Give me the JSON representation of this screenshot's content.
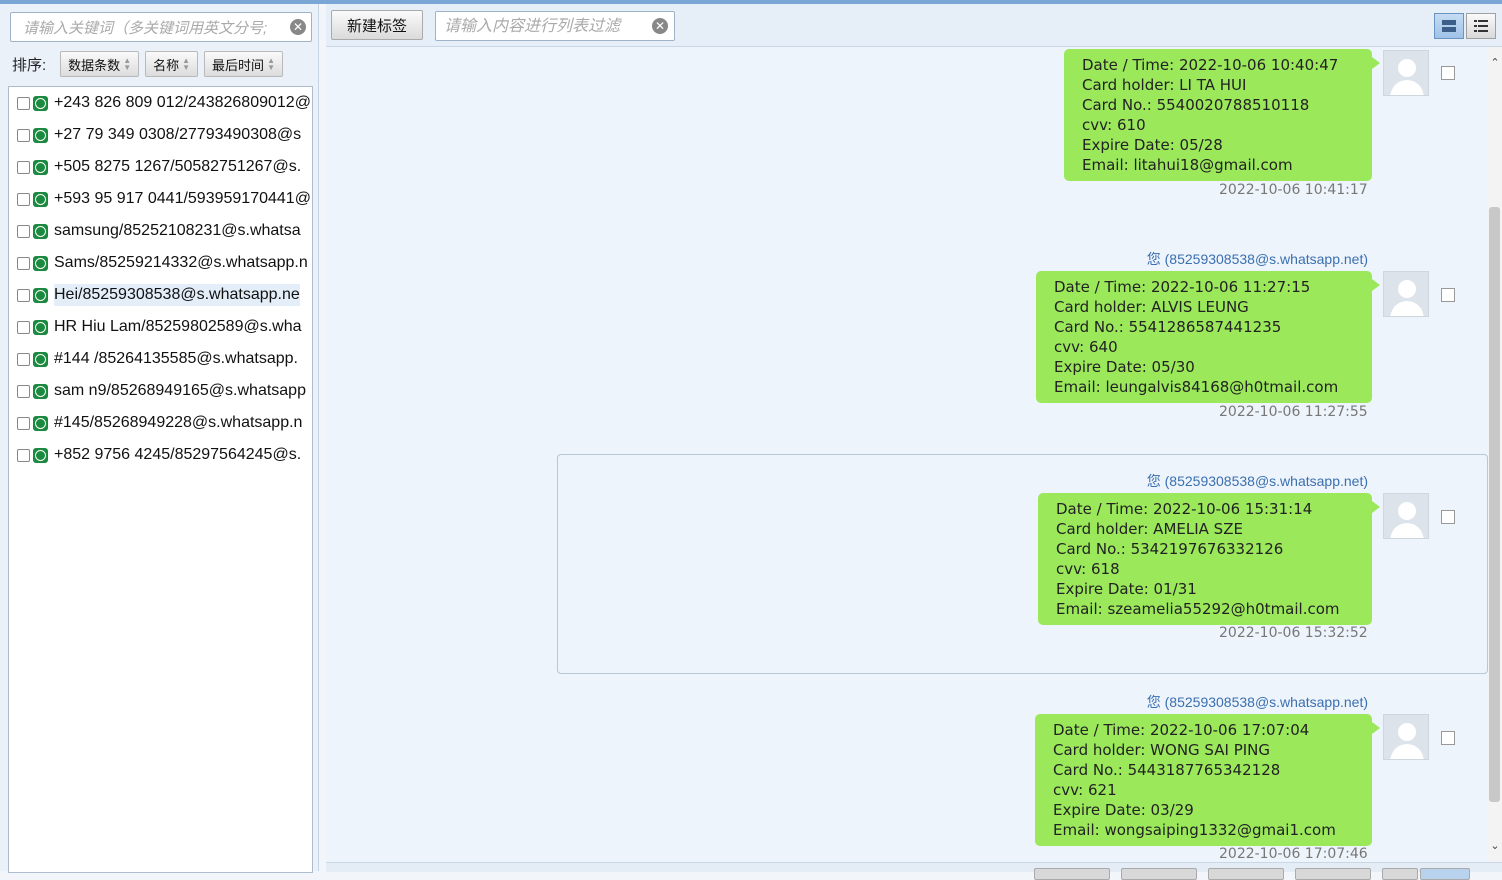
{
  "left": {
    "keyword_placeholder": "请输入关键词（多关键词用英文分号;",
    "sort_label": "排序:",
    "sort_buttons": [
      "数据条数",
      "名称",
      "最后时间"
    ],
    "contacts": [
      "+243 826 809 012/243826809012@",
      "+27 79 349 0308/27793490308@s",
      "+505 8275 1267/50582751267@s.",
      "+593 95 917 0441/593959170441@",
      "samsung/85252108231@s.whatsa",
      "Sams/85259214332@s.whatsapp.n",
      "Hei/85259308538@s.whatsapp.ne",
      "HR Hiu Lam/85259802589@s.wha",
      "#144 /85264135585@s.whatsapp.",
      "sam n9/85268949165@s.whatsapp",
      "#145/85268949228@s.whatsapp.n",
      "+852 9756 4245/85297564245@s."
    ]
  },
  "toolbar": {
    "new_tab_label": "新建标签",
    "filter_placeholder": "请输入内容进行列表过滤"
  },
  "messages": [
    {
      "sender": "",
      "lines": [
        "Date / Time: 2022-10-06 10:40:47",
        "Card holder: LI TA HUI",
        "Card No.: 5540020788510118",
        "cvv: 610",
        "Expire Date: 05/28",
        "Email: litahui18@gmail.com"
      ],
      "timestamp": "2022-10-06 10:41:17"
    },
    {
      "sender": "您 (85259308538@s.whatsapp.net)",
      "lines": [
        "Date / Time: 2022-10-06 11:27:15",
        "Card holder: ALVIS LEUNG",
        "Card No.: 5541286587441235",
        "cvv: 640",
        "Expire Date: 05/30",
        "Email: leungalvis84168@h0tmail.com"
      ],
      "timestamp": "2022-10-06 11:27:55"
    },
    {
      "sender": "您 (85259308538@s.whatsapp.net)",
      "lines": [
        "Date / Time: 2022-10-06 15:31:14",
        "Card holder: AMELIA SZE",
        "Card No.: 5342197676332126",
        "cvv: 618",
        "Expire Date: 01/31",
        "Email: szeamelia55292@h0tmail.com"
      ],
      "timestamp": "2022-10-06 15:32:52"
    },
    {
      "sender": "您 (85259308538@s.whatsapp.net)",
      "lines": [
        "Date / Time: 2022-10-06 17:07:04",
        "Card holder: WONG SAI PING",
        "Card No.: 5443187765342128",
        "cvv: 621",
        "Expire Date: 03/29",
        "Email: wongsaiping1332@gmai1.com"
      ],
      "timestamp": "2022-10-06 17:07:46"
    }
  ],
  "colors": {
    "bubble": "#9be85b",
    "accent": "#7aa6d6",
    "sender": "#3a6fb0"
  },
  "icons": [
    "clear-icon",
    "whatsapp-icon",
    "sort-arrows-icon",
    "tile-view-icon",
    "list-view-icon",
    "avatar-icon",
    "scroll-up-icon",
    "scroll-down-icon"
  ]
}
